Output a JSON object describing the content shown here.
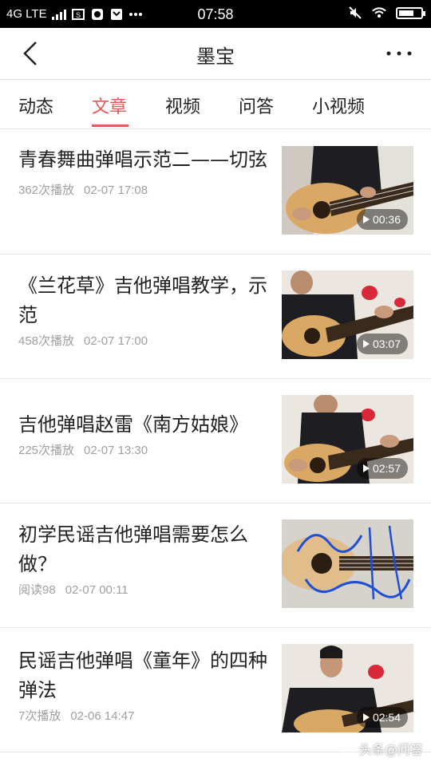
{
  "status_bar": {
    "network": "4G LTE",
    "time": "07:58"
  },
  "header": {
    "title": "墨宝"
  },
  "tabs": [
    {
      "label": "动态",
      "active": false
    },
    {
      "label": "文章",
      "active": true
    },
    {
      "label": "视频",
      "active": false
    },
    {
      "label": "问答",
      "active": false
    },
    {
      "label": "小视频",
      "active": false
    }
  ],
  "accent_color": "#e05a5a",
  "feed": [
    {
      "title": "青春舞曲弹唱示范二——切弦",
      "stat": "362次播放",
      "date": "02-07 17:08",
      "duration": "00:36"
    },
    {
      "title": "《兰花草》吉他弹唱教学，示范",
      "stat": "458次播放",
      "date": "02-07 17:00",
      "duration": "03:07"
    },
    {
      "title": "吉他弹唱赵雷《南方姑娘》",
      "stat": "225次播放",
      "date": "02-07 13:30",
      "duration": "02:57"
    },
    {
      "title": "初学民谣吉他弹唱需要怎么做？",
      "stat": "阅读98",
      "date": "02-07 00:11",
      "duration": null
    },
    {
      "title": "民谣吉他弹唱《童年》的四种弹法",
      "stat": "7次播放",
      "date": "02-06 14:47",
      "duration": "02:54"
    }
  ],
  "watermark": "头条@问答"
}
